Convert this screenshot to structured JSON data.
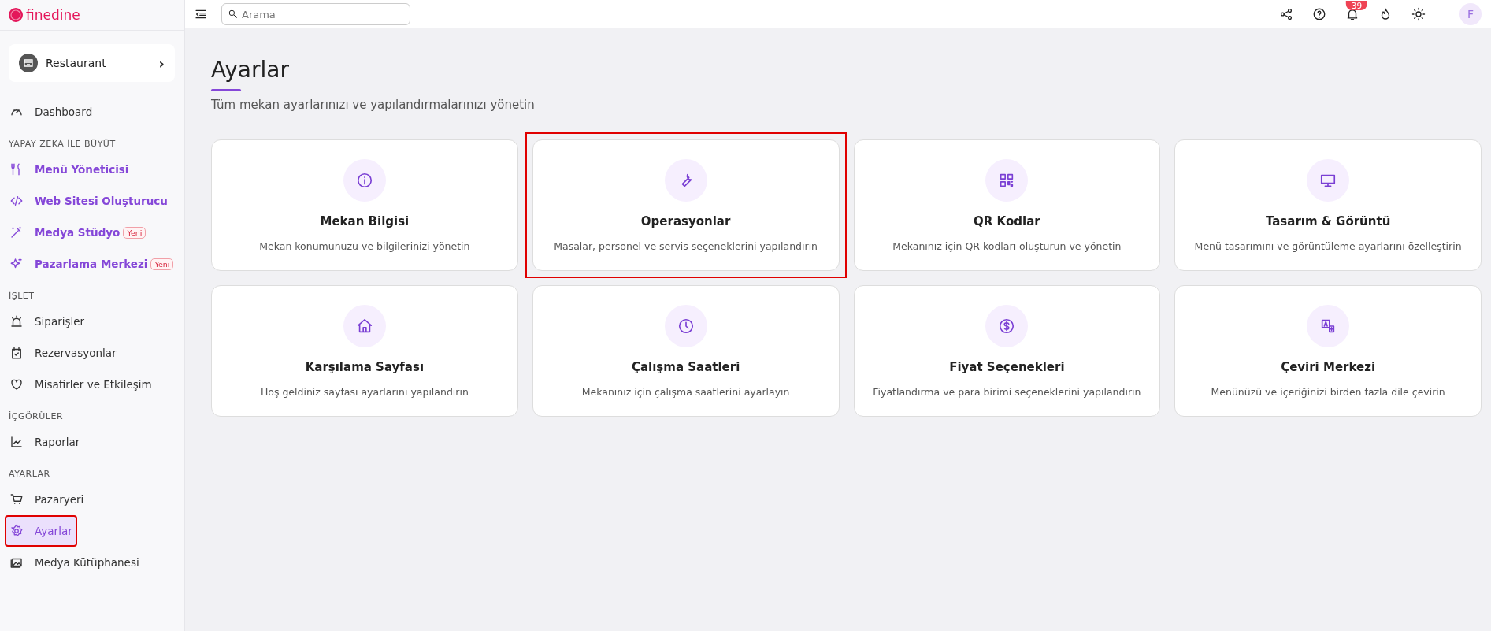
{
  "brand": {
    "name": "finedine"
  },
  "venue": {
    "name": "Restaurant",
    "chevron": "›"
  },
  "sidebar": {
    "top_items": [
      {
        "label": "Dashboard",
        "selected": false,
        "highlighted": false
      }
    ],
    "sections": [
      {
        "title": "YAPAY ZEKA İLE BÜYÜT",
        "accent": true,
        "items": [
          {
            "label": "Menü Yöneticisi",
            "selected": false,
            "highlighted": false
          },
          {
            "label": "Web Sitesi Oluşturucu",
            "selected": false,
            "highlighted": false
          },
          {
            "label": "Medya Stüdyo",
            "badge": "Yeni",
            "selected": false,
            "highlighted": false
          },
          {
            "label": "Pazarlama Merkezi",
            "badge": "Yeni",
            "selected": false,
            "highlighted": false
          }
        ]
      },
      {
        "title": "İŞLET",
        "accent": false,
        "items": [
          {
            "label": "Siparişler",
            "selected": false,
            "highlighted": false
          },
          {
            "label": "Rezervasyonlar",
            "selected": false,
            "highlighted": false
          },
          {
            "label": "Misafirler ve Etkileşim",
            "selected": false,
            "highlighted": false
          }
        ]
      },
      {
        "title": "İÇGÖRÜLER",
        "accent": false,
        "items": [
          {
            "label": "Raporlar",
            "selected": false,
            "highlighted": false
          }
        ]
      },
      {
        "title": "AYARLAR",
        "accent": false,
        "items": [
          {
            "label": "Pazaryeri",
            "selected": false,
            "highlighted": false
          },
          {
            "label": "Ayarlar",
            "selected": true,
            "highlighted": true
          },
          {
            "label": "Medya Kütüphanesi",
            "selected": false,
            "highlighted": false
          }
        ]
      }
    ]
  },
  "header": {
    "search": {
      "placeholder": "Arama"
    },
    "notification_count": "39",
    "avatar": "F"
  },
  "page": {
    "title": "Ayarlar",
    "subtitle": "Tüm mekan ayarlarınızı ve yapılandırmalarınızı yönetin"
  },
  "cards": [
    {
      "title": "Mekan Bilgisi",
      "description": "Mekan konumunuzu ve bilgilerinizi yönetin",
      "highlighted": false
    },
    {
      "title": "Operasyonlar",
      "description": "Masalar, personel ve servis seçeneklerini yapılandırın",
      "highlighted": true
    },
    {
      "title": "QR Kodlar",
      "description": "Mekanınız için QR kodları oluşturun ve yönetin",
      "highlighted": false
    },
    {
      "title": "Tasarım & Görüntü",
      "description": "Menü tasarımını ve görüntüleme ayarlarını özelleştirin",
      "highlighted": false
    },
    {
      "title": "Karşılama Sayfası",
      "description": "Hoş geldiniz sayfası ayarlarını yapılandırın",
      "highlighted": false
    },
    {
      "title": "Çalışma Saatleri",
      "description": "Mekanınız için çalışma saatlerini ayarlayın",
      "highlighted": false
    },
    {
      "title": "Fiyat Seçenekleri",
      "description": "Fiyatlandırma ve para birimi seçeneklerini yapılandırın",
      "highlighted": false
    },
    {
      "title": "Çeviri Merkezi",
      "description": "Menünüzü ve içeriğinizi birden fazla dile çevirin",
      "highlighted": false
    }
  ]
}
